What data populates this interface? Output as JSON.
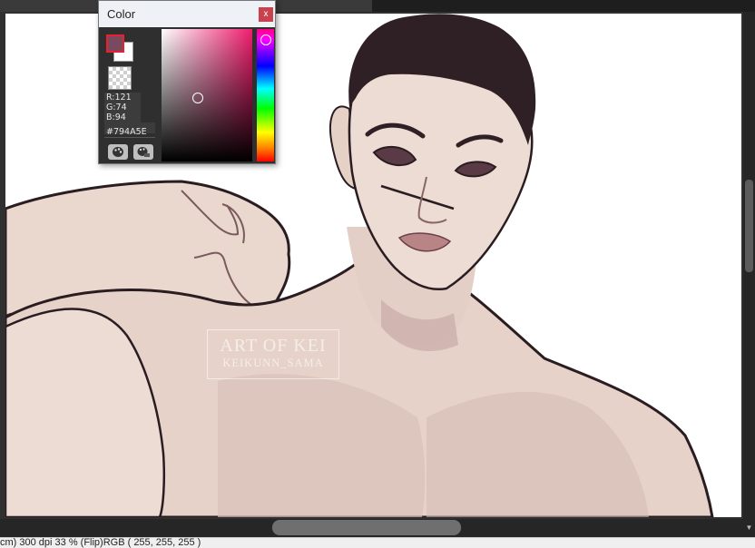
{
  "color_panel": {
    "title": "Color",
    "close_label": "x",
    "foreground_color": "#794A5E",
    "background_color": "#FFFFFF",
    "r_label": "R:121",
    "g_label": "G:74",
    "b_label": "B:94",
    "hex_label": "#794A5E",
    "tool_icons": [
      "palette-icon",
      "palette-settings-icon"
    ]
  },
  "watermark": {
    "line1": "ART OF KEI",
    "line2": "KEIKUNN_SAMA"
  },
  "status": {
    "text": "cm)  300 dpi  33 %    (Flip)RGB ( 255, 255, 255 )"
  },
  "colors": {
    "skin": "#e3d0c6",
    "skin_shadow": "#c9a8a6",
    "outline": "#2a1d22",
    "hair": "#2f2025",
    "canvas_bg": "#ffffff"
  }
}
